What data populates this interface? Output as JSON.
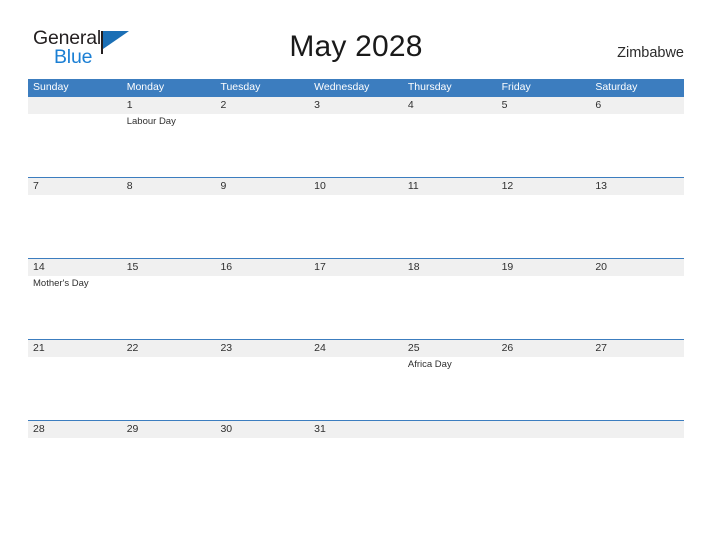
{
  "brand": {
    "name_line1": "General",
    "name_line2": "Blue",
    "flag_icon": "flag-triangle-icon",
    "accent_color": "#1b7fd4"
  },
  "header": {
    "title": "May 2028",
    "country": "Zimbabwe"
  },
  "theme": {
    "header_blue": "#3c7dbf",
    "date_band_gray": "#f0f0f0",
    "rule_blue": "#3c7dbf",
    "text_dark": "#2f2f2f"
  },
  "calendar": {
    "weekdays": [
      "Sunday",
      "Monday",
      "Tuesday",
      "Wednesday",
      "Thursday",
      "Friday",
      "Saturday"
    ],
    "weeks": [
      {
        "days": [
          {
            "date": "",
            "event": ""
          },
          {
            "date": "1",
            "event": "Labour Day"
          },
          {
            "date": "2",
            "event": ""
          },
          {
            "date": "3",
            "event": ""
          },
          {
            "date": "4",
            "event": ""
          },
          {
            "date": "5",
            "event": ""
          },
          {
            "date": "6",
            "event": ""
          }
        ]
      },
      {
        "days": [
          {
            "date": "7",
            "event": ""
          },
          {
            "date": "8",
            "event": ""
          },
          {
            "date": "9",
            "event": ""
          },
          {
            "date": "10",
            "event": ""
          },
          {
            "date": "11",
            "event": ""
          },
          {
            "date": "12",
            "event": ""
          },
          {
            "date": "13",
            "event": ""
          }
        ]
      },
      {
        "days": [
          {
            "date": "14",
            "event": "Mother's Day"
          },
          {
            "date": "15",
            "event": ""
          },
          {
            "date": "16",
            "event": ""
          },
          {
            "date": "17",
            "event": ""
          },
          {
            "date": "18",
            "event": ""
          },
          {
            "date": "19",
            "event": ""
          },
          {
            "date": "20",
            "event": ""
          }
        ]
      },
      {
        "days": [
          {
            "date": "21",
            "event": ""
          },
          {
            "date": "22",
            "event": ""
          },
          {
            "date": "23",
            "event": ""
          },
          {
            "date": "24",
            "event": ""
          },
          {
            "date": "25",
            "event": "Africa Day"
          },
          {
            "date": "26",
            "event": ""
          },
          {
            "date": "27",
            "event": ""
          }
        ]
      },
      {
        "days": [
          {
            "date": "28",
            "event": ""
          },
          {
            "date": "29",
            "event": ""
          },
          {
            "date": "30",
            "event": ""
          },
          {
            "date": "31",
            "event": ""
          },
          {
            "date": "",
            "event": ""
          },
          {
            "date": "",
            "event": ""
          },
          {
            "date": "",
            "event": ""
          }
        ]
      }
    ]
  }
}
